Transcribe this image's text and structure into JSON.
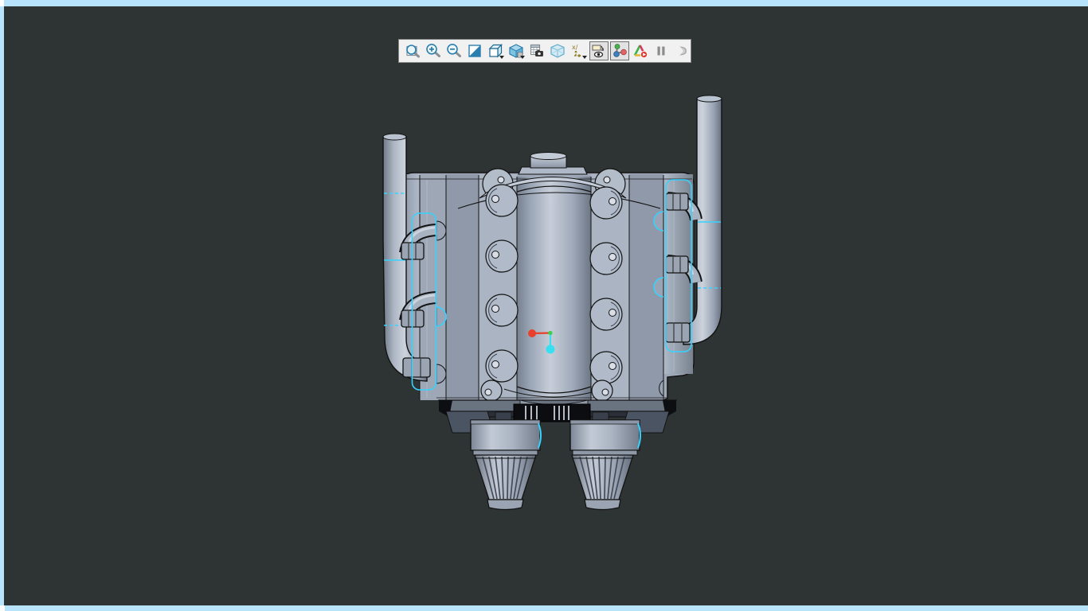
{
  "app": {
    "background_color": "#2e3433",
    "frame_border_color": "#b7e3fc",
    "frame_notch_color": "#ffffff"
  },
  "toolbar": {
    "background_color": "#f1f1f1",
    "border_color": "#8a8a8a",
    "pressed_background": "#e2e2e2",
    "axes_glyph": "x/",
    "buttons": [
      {
        "name": "zoom-to-fit",
        "state": "normal"
      },
      {
        "name": "zoom-in",
        "state": "normal"
      },
      {
        "name": "zoom-out",
        "state": "normal"
      },
      {
        "name": "section-view",
        "state": "normal"
      },
      {
        "name": "view-orientation",
        "state": "normal",
        "dropdown": true
      },
      {
        "name": "display-style",
        "state": "normal",
        "dropdown": true
      },
      {
        "name": "image-capture",
        "state": "normal"
      },
      {
        "name": "perspective-view",
        "state": "normal"
      },
      {
        "name": "hide-show-annotations",
        "state": "normal",
        "dropdown": true
      },
      {
        "name": "component-display",
        "state": "pressed"
      },
      {
        "name": "move-component",
        "state": "pressed"
      },
      {
        "name": "play-animation",
        "state": "normal"
      },
      {
        "name": "pause",
        "state": "normal"
      },
      {
        "name": "record",
        "state": "disabled"
      }
    ]
  },
  "viewport": {
    "model": {
      "body_color": "#a7b1c0",
      "edge_color": "#131313",
      "highlight_color": "#36d3ff",
      "parts": [
        "engine-block",
        "supercharger-cylinder",
        "oil-fill-cap",
        "left-exhaust-pipe",
        "right-exhaust-pipe",
        "left-valve-cover",
        "right-valve-cover",
        "drive-belt",
        "left-intake-drum",
        "right-intake-drum",
        "left-intake-cone",
        "right-intake-cone"
      ]
    },
    "origin_triad": {
      "x_axis_color": "#e8402a",
      "y_axis_color": "#37e0f0",
      "origin_color": "#35d44a"
    }
  }
}
